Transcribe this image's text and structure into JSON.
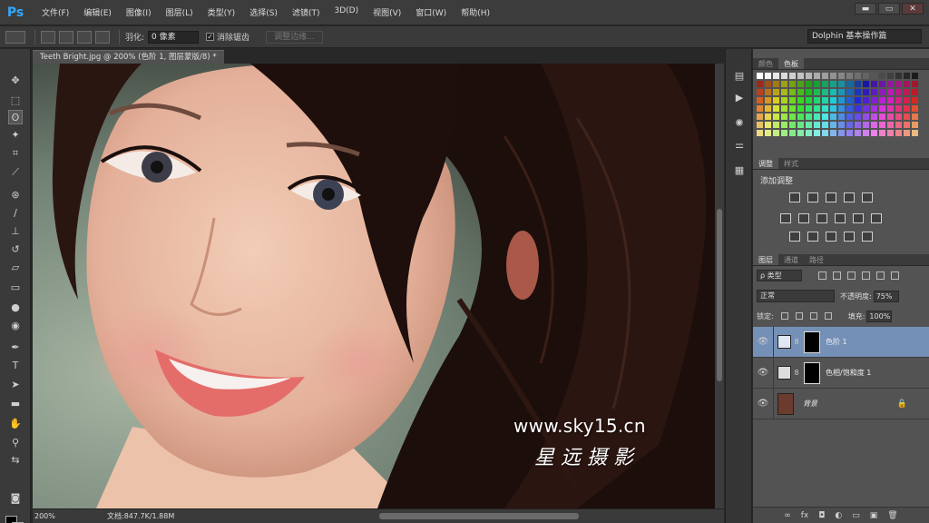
{
  "app": {
    "logo": "Ps"
  },
  "menu": [
    "文件(F)",
    "编辑(E)",
    "图像(I)",
    "图层(L)",
    "类型(Y)",
    "选择(S)",
    "滤镜(T)",
    "3D(D)",
    "视图(V)",
    "窗口(W)",
    "帮助(H)"
  ],
  "window_controls": [
    "▬",
    "▭",
    "✕"
  ],
  "options": {
    "feather_label": "羽化:",
    "feather_value": "0 像素",
    "antialias_label": "消除锯齿",
    "antialias_checked": "✓",
    "refine_edge": "调整边缘...",
    "workspace": "Dolphin 基本操作篇"
  },
  "document": {
    "tab": "Teeth Bright.jpg @ 200% (色阶 1, 图层蒙版/8) *",
    "zoom": "200%",
    "doc_info": "文档:847.7K/1.88M"
  },
  "watermark": {
    "url": "www.sky15.cn",
    "name": "星远摄影"
  },
  "panels": {
    "swatches_tabs": [
      "颜色",
      "色板"
    ],
    "adjust_tabs": [
      "调整",
      "样式"
    ],
    "adjust_title": "添加调整",
    "layers_tabs": [
      "图层",
      "通道",
      "路径"
    ],
    "layers_kind": "ρ 类型",
    "blend_mode": "正常",
    "opacity_label": "不透明度:",
    "opacity": "75%",
    "lock_label": "锁定:",
    "fill_label": "填充:",
    "fill": "100%",
    "layers": [
      {
        "name": "色阶 1",
        "selected": true
      },
      {
        "name": "色相/饱和度 1",
        "selected": false
      },
      {
        "name": "背景",
        "selected": false,
        "locked": true
      }
    ]
  },
  "colors": {
    "accent": "#31a8ff",
    "selected_layer": "#7590b7"
  }
}
